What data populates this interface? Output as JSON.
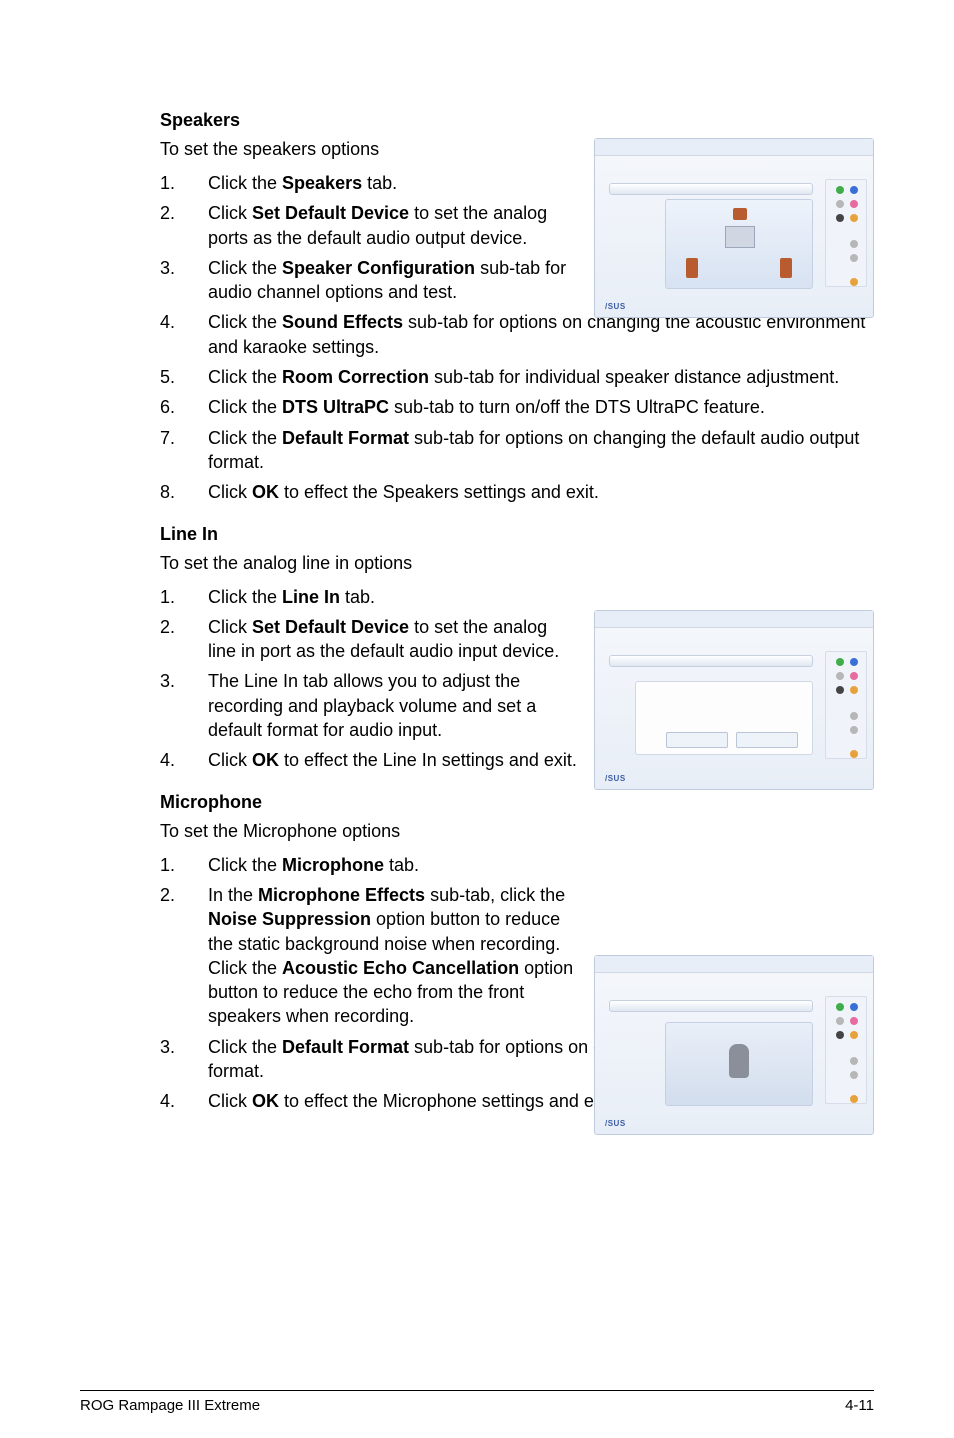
{
  "footer": {
    "left": "ROG Rampage III Extreme",
    "right": "4-11"
  },
  "sections": {
    "speakers": {
      "heading": "Speakers",
      "intro": "To set the speakers options",
      "items": [
        {
          "n": "1.",
          "pre": "Click the ",
          "b": "Speakers",
          "post": " tab."
        },
        {
          "n": "2.",
          "pre": "Click ",
          "b": "Set Default Device",
          "post": " to set the analog ports as the default audio output device."
        },
        {
          "n": "3.",
          "pre": "Click the ",
          "b": "Speaker Configuration",
          "post": " sub-tab for audio channel options and test."
        },
        {
          "n": "4.",
          "pre": "Click the ",
          "b": "Sound Effects",
          "post": " sub-tab for options on changing the acoustic environment and karaoke settings."
        },
        {
          "n": "5.",
          "pre": "Click the ",
          "b": "Room Correction",
          "post": " sub-tab for individual speaker distance adjustment."
        },
        {
          "n": "6.",
          "pre": "Click the ",
          "b": "DTS UltraPC",
          "post": " sub-tab to turn on/off the DTS UltraPC feature."
        },
        {
          "n": "7.",
          "pre": "Click the ",
          "b": "Default Format",
          "post": " sub-tab for options on changing the default audio output format."
        },
        {
          "n": "8.",
          "pre": "Click ",
          "b": "OK",
          "post": " to effect the Speakers settings and exit."
        }
      ]
    },
    "linein": {
      "heading": "Line In",
      "intro": "To set the analog line in options",
      "items": [
        {
          "n": "1.",
          "pre": "Click the ",
          "b": "Line In",
          "post": " tab."
        },
        {
          "n": "2.",
          "pre": "Click ",
          "b": "Set Default Device",
          "post": " to set the analog line in port as the default audio input device."
        },
        {
          "n": "3.",
          "pre": "",
          "b": "",
          "post": "The Line In tab allows you to adjust the recording and playback volume and set a default format for audio input."
        },
        {
          "n": "4.",
          "pre": "Click ",
          "b": "OK",
          "post": " to effect the Line In settings and exit."
        }
      ]
    },
    "mic": {
      "heading": "Microphone",
      "intro": "To set the Microphone options",
      "items": [
        {
          "n": "1.",
          "pre": "Click the ",
          "b": "Microphone",
          "post": " tab."
        },
        {
          "n": "2.",
          "html": "In the <strong>Microphone Effects</strong> sub-tab, click the <strong>Noise Suppression</strong> option button to reduce the static background noise when recording. Click the <strong>Acoustic Echo Cancellation</strong> option button to reduce the echo from the front speakers when recording."
        },
        {
          "n": "3.",
          "pre": "Click the ",
          "b": "Default Format",
          "post": " sub-tab for options on changing the default audio input format."
        },
        {
          "n": "4.",
          "pre": "Click ",
          "b": "OK",
          "post": " to effect the Microphone settings and exit."
        }
      ]
    }
  },
  "screenshots": {
    "logo": "/SUS"
  }
}
